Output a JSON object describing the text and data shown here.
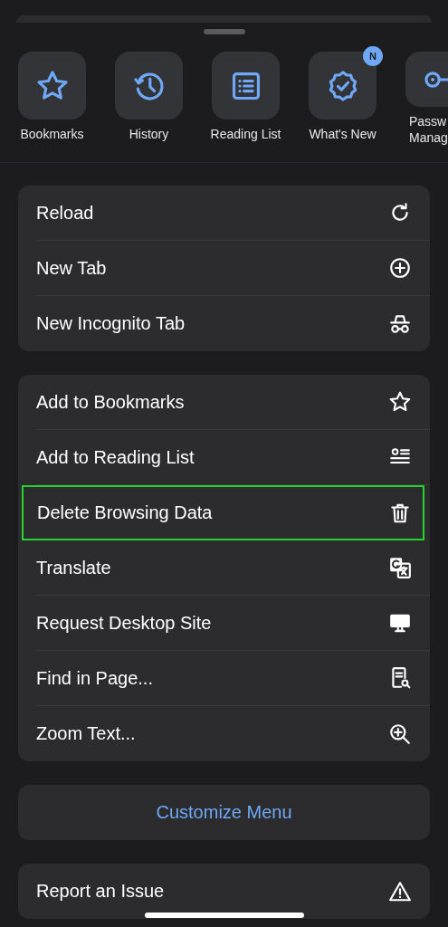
{
  "quick_actions": [
    {
      "label": "Bookmarks"
    },
    {
      "label": "History"
    },
    {
      "label": "Reading List"
    },
    {
      "label": "What's New",
      "badge": "N"
    },
    {
      "label": "Passw\nManag"
    }
  ],
  "menu_groups": [
    {
      "items": [
        {
          "label": "Reload",
          "highlighted": false
        },
        {
          "label": "New Tab",
          "highlighted": false
        },
        {
          "label": "New Incognito Tab",
          "highlighted": false
        }
      ]
    },
    {
      "items": [
        {
          "label": "Add to Bookmarks",
          "highlighted": false
        },
        {
          "label": "Add to Reading List",
          "highlighted": false
        },
        {
          "label": "Delete Browsing Data",
          "highlighted": true
        },
        {
          "label": "Translate",
          "highlighted": false
        },
        {
          "label": "Request Desktop Site",
          "highlighted": false
        },
        {
          "label": "Find in Page...",
          "highlighted": false
        },
        {
          "label": "Zoom Text...",
          "highlighted": false
        }
      ]
    }
  ],
  "customize_button": "Customize Menu",
  "bottom_group": {
    "items": [
      {
        "label": "Report an Issue",
        "highlighted": false
      }
    ]
  }
}
